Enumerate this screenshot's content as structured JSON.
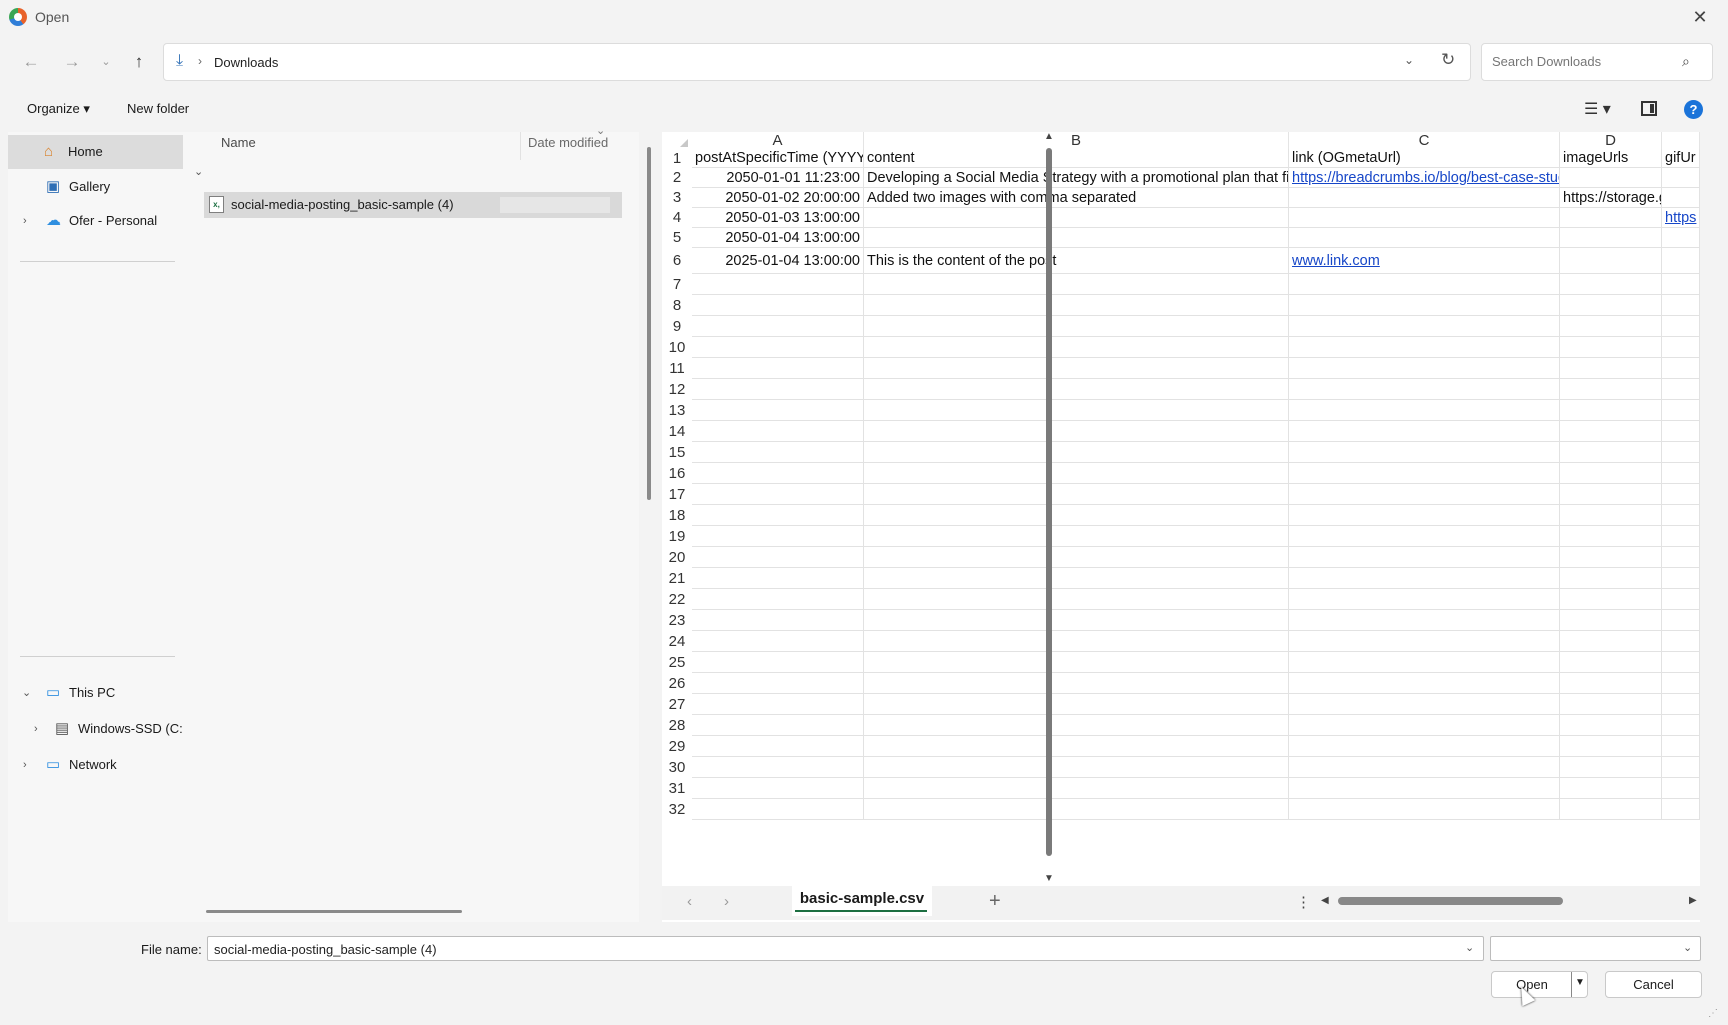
{
  "window": {
    "title": "Open"
  },
  "nav": {
    "address": "Downloads",
    "search_placeholder": "Search Downloads"
  },
  "commands": {
    "organize": "Organize ▾",
    "new_folder": "New folder"
  },
  "sidebar": {
    "items": [
      {
        "label": "Home",
        "icon": "home-icon"
      },
      {
        "label": "Gallery",
        "icon": "gallery-icon"
      },
      {
        "label": "Ofer - Personal",
        "icon": "cloud-icon"
      },
      {
        "label": "This PC",
        "icon": "computer-icon"
      },
      {
        "label": "Windows-SSD (C:",
        "icon": "drive-icon"
      },
      {
        "label": "Network",
        "icon": "network-icon"
      }
    ]
  },
  "file_list": {
    "columns": {
      "name": "Name",
      "date": "Date modified"
    },
    "files": [
      {
        "name": "social-media-posting_basic-sample (4)",
        "icon": "csv-file-icon"
      }
    ]
  },
  "spreadsheet": {
    "columns": [
      "A",
      "B",
      "C",
      "D"
    ],
    "rows": [
      [
        "postAtSpecificTime (YYYY-",
        "content",
        "link (OGmetaUrl)",
        "imageUrls",
        "gifUr"
      ],
      [
        "2050-01-01 11:23:00",
        "Developing a Social Media Strategy with a promotional plan that fits",
        "https://breadcrumbs.io/blog/best-case-study-questions",
        "",
        ""
      ],
      [
        "2050-01-02 20:00:00",
        "Added two images with comma separated",
        "",
        "https://storage.googl",
        ""
      ],
      [
        "2050-01-03 13:00:00",
        "",
        "",
        "",
        "https"
      ],
      [
        "2050-01-04 13:00:00",
        "",
        "",
        "",
        ""
      ],
      [
        "2025-01-04 13:00:00",
        "This is the content of the post",
        "www.link.com",
        "",
        ""
      ]
    ],
    "row_numbers": [
      "1",
      "2",
      "3",
      "4",
      "5",
      "6",
      "7",
      "8",
      "9",
      "10",
      "11",
      "12",
      "13",
      "14",
      "15",
      "16",
      "17",
      "18",
      "19",
      "20",
      "21",
      "22",
      "23",
      "24",
      "25",
      "26",
      "27",
      "28",
      "29",
      "30",
      "31",
      "32"
    ],
    "sheet_tab": "basic-sample.csv"
  },
  "bottom": {
    "filename_label": "File name:",
    "filename_value": "social-media-posting_basic-sample (4)",
    "filetype_value": "",
    "open_label": "Open",
    "cancel_label": "Cancel"
  }
}
